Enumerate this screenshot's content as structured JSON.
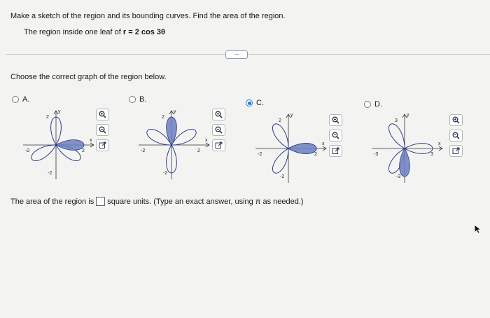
{
  "question": {
    "instruction": "Make a sketch of the region and its bounding curves. Find the area of the region.",
    "prompt_prefix": "The region inside one leaf of",
    "prompt_equation": "r = 2 cos 3θ"
  },
  "more_button": "····",
  "choose_text": "Choose the correct graph of the region below.",
  "options": [
    {
      "label": "A.",
      "selected": false,
      "xtick": "2",
      "xtick_neg": "-2",
      "ytick": "2",
      "ytick_neg": "-2",
      "xaxis": "x",
      "yaxis": "y"
    },
    {
      "label": "B.",
      "selected": false,
      "xtick": "2",
      "xtick_neg": "-2",
      "ytick": "2",
      "ytick_neg": "-2",
      "xaxis": "x",
      "yaxis": "y"
    },
    {
      "label": "C.",
      "selected": true,
      "xtick": "2",
      "xtick_neg": "-2",
      "ytick": "2",
      "ytick_neg": "-2",
      "xaxis": "x",
      "yaxis": "y"
    },
    {
      "label": "D.",
      "selected": false,
      "xtick": "3",
      "xtick_neg": "-3",
      "ytick": "3",
      "ytick_neg": "-3",
      "xaxis": "x",
      "yaxis": "y"
    }
  ],
  "tools": [
    "zoom-in-icon",
    "zoom-out-icon",
    "open-new-window-icon"
  ],
  "answer": {
    "prefix": "The area of the region is",
    "value": "",
    "suffix": "square units. (Type an exact answer, using π as needed.)"
  },
  "colors": {
    "selected_radio": "#2a6fdb",
    "curve": "#2c3e8f",
    "shade": "#6c7fc0"
  }
}
